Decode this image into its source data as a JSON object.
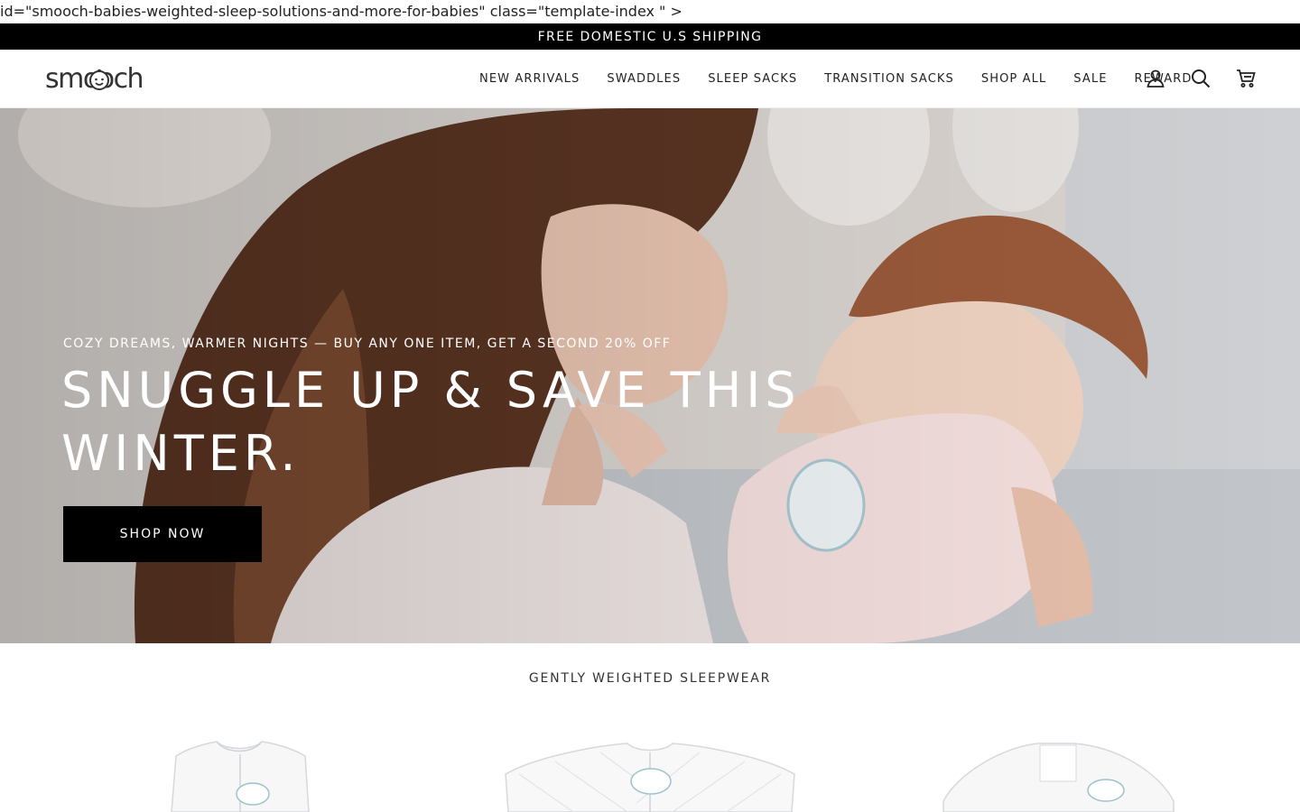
{
  "stray_text": "id=\"smooch-babies-weighted-sleep-solutions-and-more-for-babies\" class=\"template-index \" >",
  "announcement": "FREE DOMESTIC U.S SHIPPING",
  "brand": {
    "logo_text": "smooch"
  },
  "nav": {
    "items": [
      {
        "label": "NEW ARRIVALS"
      },
      {
        "label": "SWADDLES"
      },
      {
        "label": "SLEEP SACKS"
      },
      {
        "label": "TRANSITION SACKS"
      },
      {
        "label": "SHOP ALL"
      },
      {
        "label": "SALE"
      },
      {
        "label": "REWARD"
      }
    ],
    "icons": [
      "account-icon",
      "search-icon",
      "cart-icon"
    ]
  },
  "hero": {
    "kicker": "COZY DREAMS, WARMER NIGHTS — BUY ANY ONE ITEM, GET A SECOND 20% OFF",
    "title": "SNUGGLE UP & SAVE THIS WINTER.",
    "button_label": "SHOP NOW"
  },
  "section": {
    "title": "GENTLY WEIGHTED SLEEPWEAR"
  },
  "colors": {
    "announcement_bg": "#000000",
    "button_bg": "#000000",
    "text": "#222222"
  }
}
